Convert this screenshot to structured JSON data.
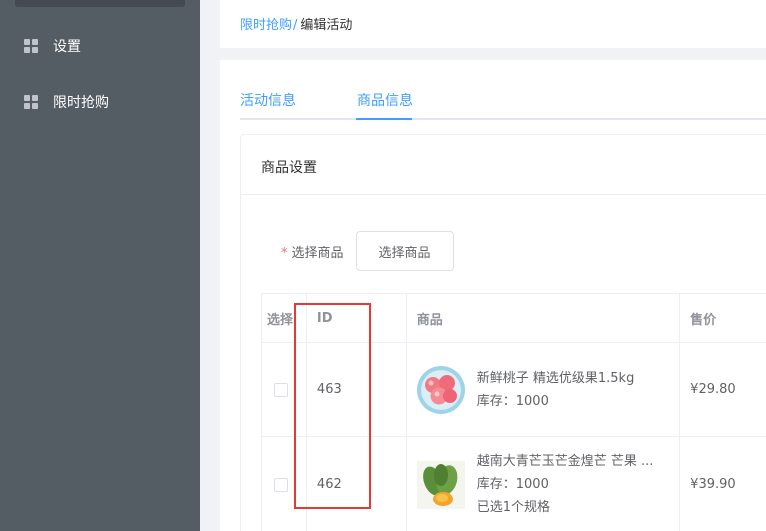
{
  "sidebar": {
    "items": [
      {
        "label": "设置",
        "icon": "grid-icon"
      },
      {
        "label": "限时抢购",
        "icon": "grid-icon"
      }
    ]
  },
  "breadcrumb": {
    "parent": "限时抢购",
    "separator": "/",
    "current": "编辑活动"
  },
  "tabs": [
    {
      "label": "活动信息",
      "active": false
    },
    {
      "label": "商品信息",
      "active": true
    }
  ],
  "card": {
    "title": "商品设置",
    "form": {
      "required_mark": "*",
      "label": "选择商品",
      "button_label": "选择商品"
    }
  },
  "table": {
    "headers": [
      "选择",
      "ID",
      "商品",
      "售价"
    ],
    "stock_prefix": "库存：",
    "rows": [
      {
        "id": "463",
        "name": "新鲜桃子 精选优级果1.5kg",
        "stock": "1000",
        "note": "",
        "price": "¥29.80",
        "thumb": "peach-image"
      },
      {
        "id": "462",
        "name": "越南大青芒玉芒金煌芒 芒果 ...",
        "stock": "1000",
        "note": "已选1个规格",
        "price": "¥39.90",
        "thumb": "mango-image"
      }
    ]
  },
  "colors": {
    "sidebar_bg": "#545c64",
    "accent": "#409eff",
    "required": "#f56c6c",
    "highlight_box": "#e53935"
  }
}
